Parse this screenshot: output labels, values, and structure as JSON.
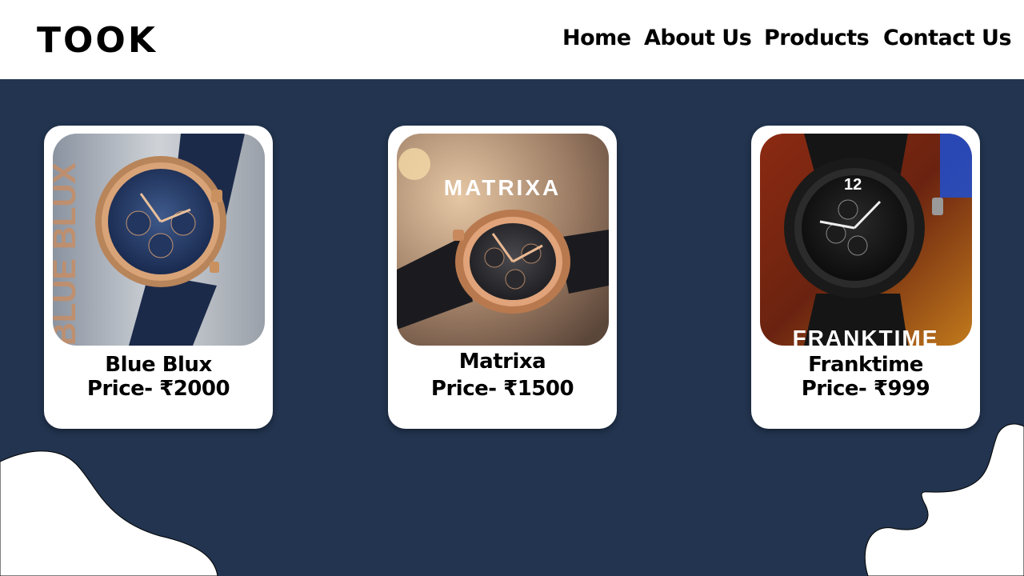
{
  "brand": {
    "logo": "TOOK"
  },
  "nav": [
    {
      "label": "Home"
    },
    {
      "label": "About Us"
    },
    {
      "label": "Products"
    },
    {
      "label": "Contact Us"
    }
  ],
  "products": [
    {
      "name": "Blue Blux",
      "price_label": "Price-",
      "price": "₹2000",
      "image_text": "BLUE BLUX",
      "image": "watch-blue-dial-rose-gold"
    },
    {
      "name": "Matrixa",
      "price_label": "Price-",
      "price": "₹1500",
      "image_text": "MATRIXA",
      "image": "watch-black-dial-rose-gold"
    },
    {
      "name": "Franktime",
      "price_label": "Price-",
      "price": "₹999",
      "image_text": "FRANKTIME",
      "image": "watch-all-black"
    }
  ],
  "colors": {
    "background": "#22344f",
    "surface": "#ffffff",
    "text": "#000000"
  }
}
